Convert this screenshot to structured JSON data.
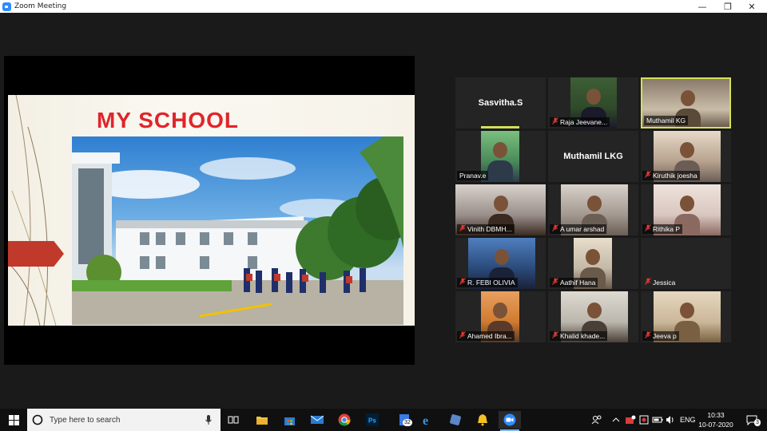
{
  "window": {
    "title": "Zoom Meeting",
    "controls": {
      "minimize": "—",
      "maximize": "❐",
      "close": "✕"
    }
  },
  "share": {
    "slide_title": "MY SCHOOL"
  },
  "participants": [
    {
      "name": "Sasvitha.S",
      "video": false,
      "muted": false,
      "speaking": true
    },
    {
      "name": "Raja Jeevane...",
      "video": true,
      "muted": true
    },
    {
      "name": "Muthamil KG",
      "video": true,
      "muted": false,
      "active": true
    },
    {
      "name": "Pranav.e",
      "video": true,
      "muted": false
    },
    {
      "name": "Muthamil LKG",
      "video": false,
      "muted": false
    },
    {
      "name": "Kiruthik joesha",
      "video": true,
      "muted": true
    },
    {
      "name": "Vinith DBMH...",
      "video": true,
      "muted": true
    },
    {
      "name": "A umar arshad",
      "video": true,
      "muted": true
    },
    {
      "name": "Rithika P",
      "video": true,
      "muted": true
    },
    {
      "name": "R. FEBI OLIVIA",
      "video": true,
      "muted": true
    },
    {
      "name": "Aathif Hana",
      "video": true,
      "muted": true
    },
    {
      "name": "Jessica",
      "video": false,
      "muted": true
    },
    {
      "name": "Ahamed Ibra...",
      "video": true,
      "muted": true
    },
    {
      "name": "Khalid khade...",
      "video": true,
      "muted": true
    },
    {
      "name": "Jeeva p",
      "video": true,
      "muted": true
    }
  ],
  "taskbar": {
    "search_placeholder": "Type here to search",
    "mail_badge": "32",
    "language": "ENG",
    "time": "10:33",
    "date": "10-07-2020",
    "notification_count": "3"
  }
}
